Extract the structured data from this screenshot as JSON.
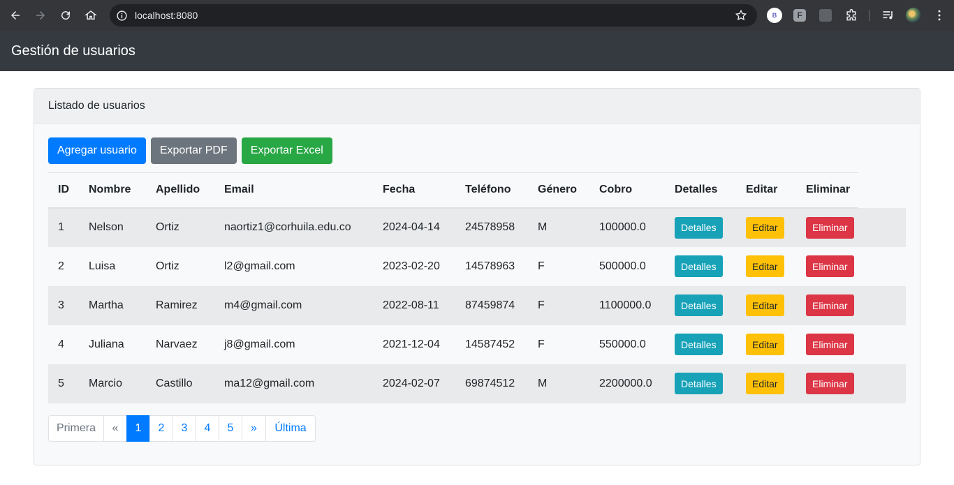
{
  "browser": {
    "url": "localhost:8080",
    "extensions": [
      {
        "icon": "letter-b-extension-icon",
        "letter": "B"
      },
      {
        "icon": "f-extension-icon",
        "letter": "F"
      },
      {
        "icon": "grid-extension-icon"
      },
      {
        "icon": "puzzle-extensions-icon"
      },
      {
        "icon": "media-control-icon"
      }
    ]
  },
  "header": {
    "title": "Gestión de usuarios"
  },
  "card": {
    "title": "Listado de usuarios",
    "buttons": {
      "add": "Agregar usuario",
      "pdf": "Exportar PDF",
      "excel": "Exportar Excel"
    }
  },
  "table": {
    "columns": [
      "ID",
      "Nombre",
      "Apellido",
      "Email",
      "Fecha",
      "Teléfono",
      "Género",
      "Cobro",
      "Detalles",
      "Editar",
      "Eliminar"
    ],
    "rows": [
      {
        "id": "1",
        "nombre": "Nelson",
        "apellido": "Ortiz",
        "email": "naortiz1@corhuila.edu.co",
        "fecha": "2024-04-14",
        "telefono": "24578958",
        "genero": "M",
        "cobro": "100000.0"
      },
      {
        "id": "2",
        "nombre": "Luisa",
        "apellido": "Ortiz",
        "email": "l2@gmail.com",
        "fecha": "2023-02-20",
        "telefono": "14578963",
        "genero": "F",
        "cobro": "500000.0"
      },
      {
        "id": "3",
        "nombre": "Martha",
        "apellido": "Ramirez",
        "email": "m4@gmail.com",
        "fecha": "2022-08-11",
        "telefono": "87459874",
        "genero": "F",
        "cobro": "1100000.0"
      },
      {
        "id": "4",
        "nombre": "Juliana",
        "apellido": "Narvaez",
        "email": "j8@gmail.com",
        "fecha": "2021-12-04",
        "telefono": "14587452",
        "genero": "F",
        "cobro": "550000.0"
      },
      {
        "id": "5",
        "nombre": "Marcio",
        "apellido": "Castillo",
        "email": "ma12@gmail.com",
        "fecha": "2024-02-07",
        "telefono": "69874512",
        "genero": "M",
        "cobro": "2200000.0"
      }
    ],
    "actions": {
      "details": "Detalles",
      "edit": "Editar",
      "delete": "Eliminar"
    }
  },
  "pagination": {
    "first": "Primera",
    "prev": "«",
    "pages": [
      "1",
      "2",
      "3",
      "4",
      "5"
    ],
    "active": "1",
    "next": "»",
    "last": "Última"
  },
  "colors": {
    "primary": "#007bff",
    "secondary": "#6c757d",
    "success": "#28a745",
    "info": "#17a2b8",
    "warning": "#ffc107",
    "danger": "#dc3545",
    "navbar": "#343a40"
  }
}
